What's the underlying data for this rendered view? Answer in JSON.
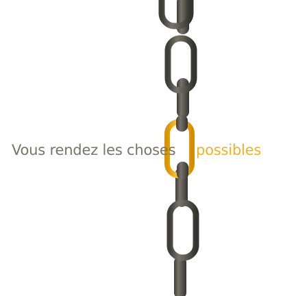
{
  "slogan": {
    "left_text": "Vous rendez les choses",
    "right_text": "possibles",
    "left_color": "#7a7466",
    "right_color": "#f3b21d"
  },
  "chain": {
    "metal_color": "#5f5c55",
    "metal_highlight": "#8a857b",
    "metal_shadow": "#3b3a36",
    "highlight_link_color": "#f4b51e",
    "highlight_link_shade": "#d99500"
  }
}
